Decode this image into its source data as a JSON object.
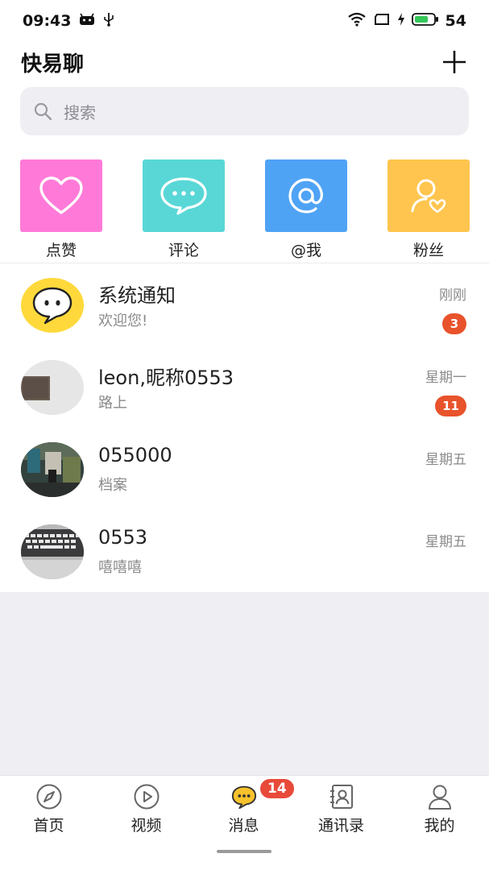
{
  "status": {
    "time": "09:43",
    "battery": "54",
    "icons": [
      "android-icon",
      "usb-icon",
      "wifi-icon",
      "sim-icon",
      "charging-icon",
      "battery-icon"
    ]
  },
  "header": {
    "title": "快易聊",
    "add_icon": "plus-icon"
  },
  "search": {
    "placeholder": "搜索",
    "icon": "search-icon"
  },
  "quick": [
    {
      "label": "点赞",
      "icon": "heart-icon",
      "color": "#ff7ad8"
    },
    {
      "label": "评论",
      "icon": "comment-icon",
      "color": "#58d7d6"
    },
    {
      "label": "@我",
      "icon": "at-icon",
      "color": "#4fa3f5"
    },
    {
      "label": "粉丝",
      "icon": "fans-icon",
      "color": "#ffc54f"
    }
  ],
  "conversations": [
    {
      "name": "系统通知",
      "sub": "欢迎您!",
      "time": "刚刚",
      "badge": "3"
    },
    {
      "name": "leon,昵称0553",
      "sub": "路上",
      "time": "星期一",
      "badge": "11"
    },
    {
      "name": "055000",
      "sub": "档案",
      "time": "星期五"
    },
    {
      "name": "0553",
      "sub": "嘻嘻嘻",
      "time": "星期五"
    }
  ],
  "tabs": [
    {
      "label": "首页",
      "icon": "compass-icon"
    },
    {
      "label": "视频",
      "icon": "play-icon"
    },
    {
      "label": "消息",
      "icon": "message-icon",
      "badge": "14"
    },
    {
      "label": "通讯录",
      "icon": "contacts-icon"
    },
    {
      "label": "我的",
      "icon": "profile-icon"
    }
  ],
  "colors": {
    "badge": "#e8532b",
    "message_tab_icon": "#f7c22c",
    "search_bg": "#efeff3"
  }
}
